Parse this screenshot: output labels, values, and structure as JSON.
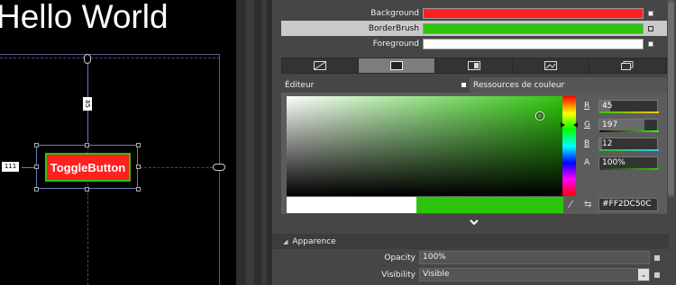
{
  "canvas": {
    "heading": "Hello World",
    "margin_top": "85",
    "margin_left": "111",
    "toggle_button_label": "ToggleButton"
  },
  "brushes": {
    "items": [
      {
        "label": "Background",
        "color": "#FF2020"
      },
      {
        "label": "BorderBrush",
        "color": "#2DC50C"
      },
      {
        "label": "Foreground",
        "color": "#FFFFFF"
      }
    ],
    "selected": "BorderBrush"
  },
  "brush_type_tabs": [
    "no-brush-icon",
    "solid-color-icon",
    "gradient-icon",
    "tile-brush-icon",
    "resource-icon"
  ],
  "editor": {
    "tab_editor": "Éditeur",
    "tab_resources": "Ressources de couleur",
    "channels": {
      "r": {
        "label": "R",
        "value": "45",
        "color": "#d03a3a"
      },
      "g": {
        "label": "G",
        "value": "197",
        "color": "#2dc50c"
      },
      "b": {
        "label": "B",
        "value": "12",
        "color": "#3aa0e0"
      },
      "a": {
        "label": "A",
        "value": "100%",
        "color": "#2dc50c"
      }
    },
    "hex": "#FF2DC50C"
  },
  "appearance": {
    "section_title": "Apparence",
    "opacity_label": "Opacity",
    "opacity_value": "100%",
    "visibility_label": "Visibility",
    "visibility_value": "Visible"
  }
}
